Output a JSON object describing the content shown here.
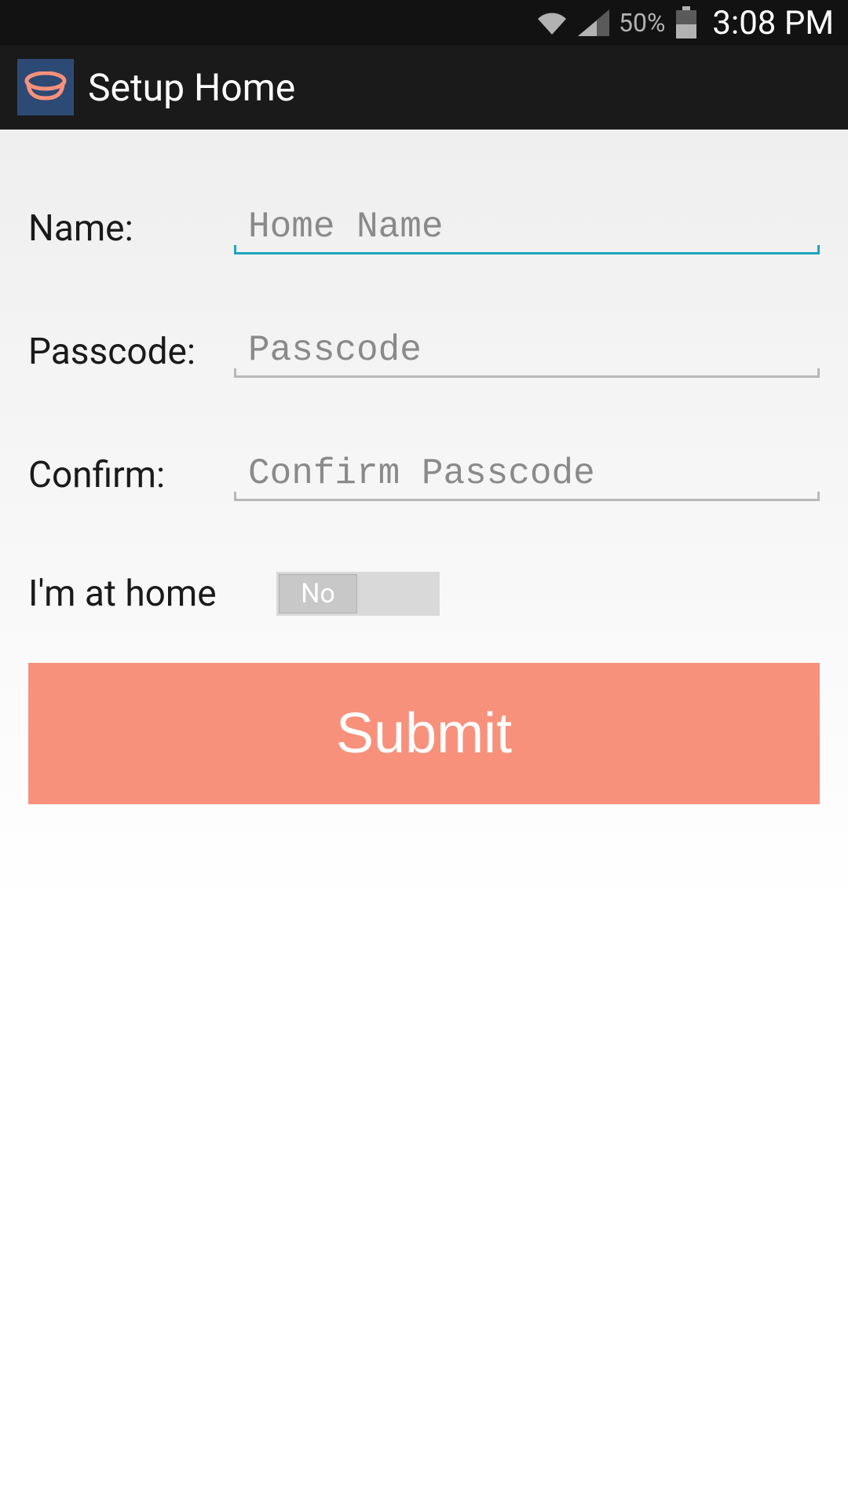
{
  "status_bar": {
    "battery_percent": "50%",
    "time": "3:08 PM"
  },
  "app_bar": {
    "title": "Setup Home"
  },
  "form": {
    "name_label": "Name:",
    "name_placeholder": "Home Name",
    "name_value": "",
    "passcode_label": "Passcode:",
    "passcode_placeholder": "Passcode",
    "passcode_value": "",
    "confirm_label": "Confirm:",
    "confirm_placeholder": "Confirm Passcode",
    "confirm_value": "",
    "at_home_label": "I'm at home",
    "toggle_value": "No",
    "submit_label": "Submit"
  }
}
